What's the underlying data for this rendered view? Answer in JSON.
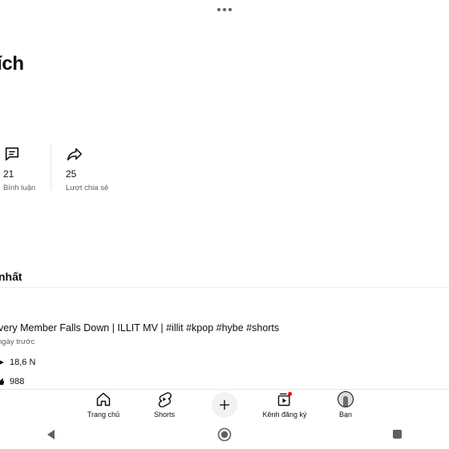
{
  "header": {
    "more_icon": "more-horizontal-icon"
  },
  "page": {
    "title": "ích"
  },
  "stats": [
    {
      "icon": "comment-icon",
      "count": "21",
      "label": "Bình luận"
    },
    {
      "icon": "share-icon",
      "count": "25",
      "label": "Lượt chia sẻ"
    }
  ],
  "section": {
    "title": "nhất"
  },
  "video": {
    "title": "very Member Falls Down | ILLIT MV | #illit #kpop #hybe #shorts",
    "time": "ngày trước",
    "views": "18,6 N",
    "likes": "988"
  },
  "bottom_nav": {
    "items": [
      {
        "label": "Trang chủ",
        "icon": "home-icon"
      },
      {
        "label": "Shorts",
        "icon": "shorts-icon"
      },
      {
        "label": "",
        "icon": "plus-icon"
      },
      {
        "label": "Kênh đăng ký",
        "icon": "subscriptions-icon",
        "badge_color": "#ff0000"
      },
      {
        "label": "Bạn",
        "icon": "avatar"
      }
    ]
  },
  "system_nav": {
    "icons": [
      "back-icon",
      "home-circle-icon",
      "recents-icon"
    ]
  },
  "colors": {
    "text": "#0f0f0f",
    "secondary": "#606060",
    "badge": "#ff0000"
  }
}
